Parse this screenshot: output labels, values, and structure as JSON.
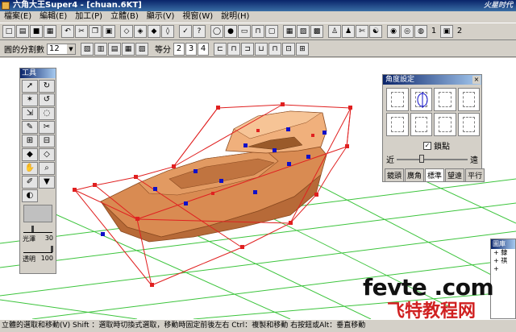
{
  "window": {
    "title": "六角大王Super4 - [chuan.6KT]",
    "watermark_corner": "火星时代"
  },
  "menu": [
    "檔案(E)",
    "編輯(E)",
    "加工(P)",
    "立體(B)",
    "顯示(V)",
    "視窗(W)",
    "說明(H)"
  ],
  "toolbar1": {
    "numbers": [
      "1",
      "2"
    ]
  },
  "toolbar2": {
    "segment_label": "圓的分割數",
    "segment_value": "12",
    "divide_label": "等分",
    "divide_options": [
      "2",
      "3",
      "4"
    ]
  },
  "tools_panel": {
    "title": "工具",
    "gloss_label": "光澤",
    "gloss_value": "30",
    "opacity_label": "透明",
    "opacity_value": "100"
  },
  "angle_panel": {
    "title": "角度設定",
    "snap_label": "鎖點",
    "snap_checked": true,
    "near_label": "近",
    "far_label": "遠",
    "tabs": [
      "鏡頭",
      "廣角",
      "標準",
      "望遠",
      "平行"
    ],
    "active_tab": "標準"
  },
  "layer_panel": {
    "title": "圖庫",
    "rows": [
      "+ 隸",
      "+ 祺",
      "+"
    ]
  },
  "statusbar": "立體的選取和移動(V)   Shift   ：選取時切換式選取，移動時固定前後左右   Ctrl：複製和移動   右按鈕或Alt：垂直移動",
  "watermark": {
    "latin": "fevte .com",
    "cjk": "飞特教程网"
  },
  "colors": {
    "boat": "#d98b52",
    "boat_shadow": "#b76a38",
    "boat_light": "#f0b07c",
    "grid": "#3cc43c",
    "wire": "#e02020",
    "point": "#1010c8"
  }
}
